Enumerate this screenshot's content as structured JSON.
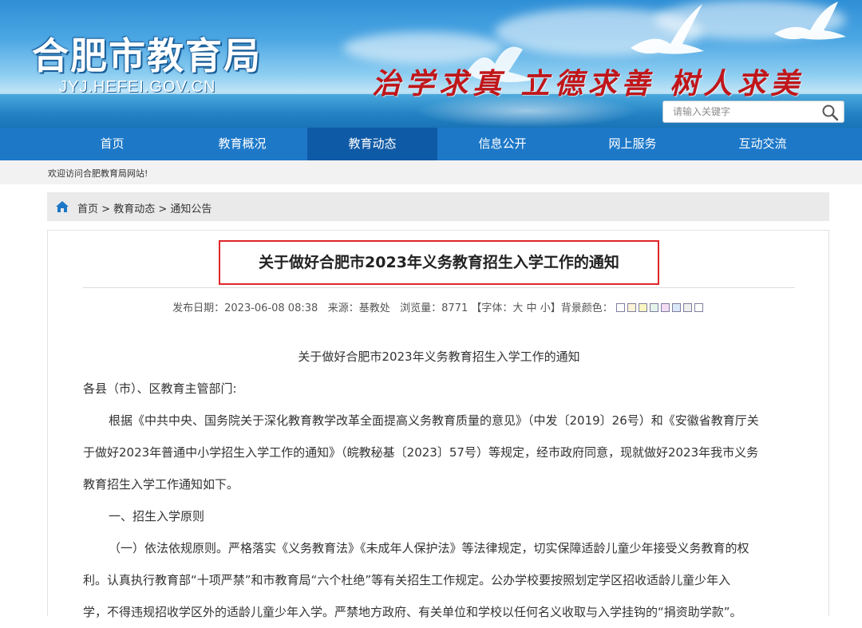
{
  "header": {
    "site_title": "合肥市教育局",
    "site_domain": "JYJ.HEFEI.GOV.CN",
    "slogan": "治学求真  立德求善  树人求美",
    "search_placeholder": "请输入关键字",
    "search_icon": "search-icon"
  },
  "nav": {
    "items": [
      {
        "label": "首页"
      },
      {
        "label": "教育概况"
      },
      {
        "label": "教育动态"
      },
      {
        "label": "信息公开"
      },
      {
        "label": "网上服务"
      },
      {
        "label": "互动交流"
      }
    ],
    "active_index": 2,
    "bg_color": "#1d78c8",
    "active_color": "#0f5aa6"
  },
  "welcome_text": "欢迎访问合肥教育局网站!",
  "breadcrumb": {
    "icon": "home-icon",
    "items": [
      "首页",
      "教育动态",
      "通知公告"
    ],
    "separator": ">"
  },
  "article": {
    "title": "关于做好合肥市2023年义务教育招生入学工作的通知",
    "title_highlight_color": "#e0262a",
    "meta": {
      "publish_label": "发布日期：",
      "publish_date": "2023-06-08 08:38",
      "source_label": "来源：",
      "source": "基教处",
      "views_label": "浏览量：",
      "views": "8771",
      "font_open": "【字体：",
      "font_large": "大",
      "font_medium": "中",
      "font_small": "小",
      "font_close": "】",
      "bg_label": "背景颜色：",
      "bg_swatches": [
        "#ffffff",
        "#fdf3d9",
        "#f8f6c2",
        "#e5f3ec",
        "#f2dcf3",
        "#d9e7f8",
        "#eeeeee",
        "#ffffff"
      ]
    },
    "subtitle": "关于做好合肥市2023年义务教育招生入学工作的通知",
    "salutation": "各县（市）、区教育主管部门:",
    "para1": [
      "根据《中共中央、国务院关于深化教育教学改革全面提高义务教育质量的意见》（中发〔2019〕26号）和《安徽省教育厅关",
      "于做好2023年普通中小学招生入学工作的通知》（皖教秘基〔2023〕57号）等规定，经市政府同意，现就做好2023年我市义务",
      "教育招生入学工作通知如下。"
    ],
    "section1": "一、招生入学原则",
    "para2": [
      "（一）依法依规原则。严格落实《义务教育法》《未成年人保护法》等法律规定，切实保障适龄儿童少年接受义务教育的权",
      "利。认真执行教育部“十项严禁”和市教育局“六个杜绝”等有关招生工作规定。公办学校要按照划定学区招收适龄儿童少年入",
      "学，不得违规招收学区外的适龄儿童少年入学。严禁地方政府、有关单位和学校以任何名义收取与入学挂钩的“捐资助学款”。"
    ]
  }
}
